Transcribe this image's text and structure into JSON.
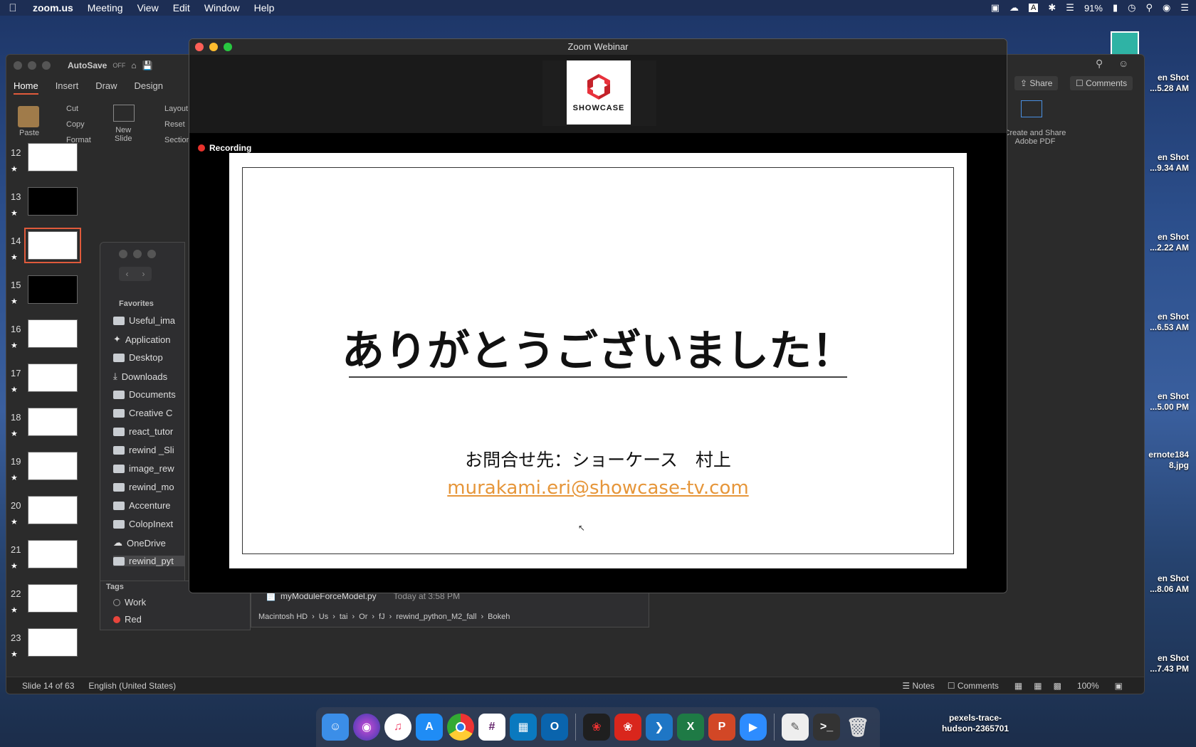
{
  "menubar": {
    "app_name": "zoom.us",
    "items": [
      "Meeting",
      "View",
      "Edit",
      "Window",
      "Help"
    ],
    "battery": "91%"
  },
  "desktop_icons": [
    {
      "line1": "en Shot",
      "line2": "...5.28 AM"
    },
    {
      "line1": "en Shot",
      "line2": "...9.34 AM"
    },
    {
      "line1": "en Shot",
      "line2": "...2.22 AM"
    },
    {
      "line1": "en Shot",
      "line2": "...6.53 AM"
    },
    {
      "line1": "en Shot",
      "line2": "...5.00 PM"
    },
    {
      "line1": "ernote184",
      "line2": "8.jpg"
    },
    {
      "line1": "en Shot",
      "line2": "...8.06 AM"
    },
    {
      "line1": "en Shot",
      "line2": "...7.43 PM"
    }
  ],
  "desktop_bottom_label": {
    "line1": "pexels-trace-",
    "line2": "hudson-2365701"
  },
  "ppt": {
    "autosave_label": "AutoSave",
    "autosave_state": "OFF",
    "tabs": [
      "Home",
      "Insert",
      "Draw",
      "Design"
    ],
    "paste": "Paste",
    "cut": "Cut",
    "copy": "Copy",
    "format": "Format",
    "new_slide": "New\nSlide",
    "layout": "Layout",
    "reset": "Reset",
    "section": "Section",
    "share": "Share",
    "comments": "Comments",
    "create_share_pdf": "Create and Share Adobe PDF",
    "slides": [
      {
        "num": "12",
        "kind": "white"
      },
      {
        "num": "13",
        "kind": "black"
      },
      {
        "num": "14",
        "kind": "white",
        "selected": true
      },
      {
        "num": "15",
        "kind": "black"
      },
      {
        "num": "16",
        "kind": "white"
      },
      {
        "num": "17",
        "kind": "white"
      },
      {
        "num": "18",
        "kind": "white"
      },
      {
        "num": "19",
        "kind": "white"
      },
      {
        "num": "20",
        "kind": "white"
      },
      {
        "num": "21",
        "kind": "white"
      },
      {
        "num": "22",
        "kind": "white"
      },
      {
        "num": "23",
        "kind": "white"
      }
    ],
    "status_slide": "Slide 14 of 63",
    "status_language": "English (United States)",
    "notes": "Notes",
    "comments_btn": "Comments",
    "zoom_level": "100%"
  },
  "finder": {
    "favorites_heading": "Favorites",
    "favorites": [
      "Useful_ima",
      "Application",
      "Desktop",
      "Downloads",
      "Documents",
      "Creative C",
      "react_tutor",
      "rewind _Sli",
      "image_rew",
      "rewind_mo",
      "Accenture",
      "ColopInext",
      "OneDrive",
      "rewind_pyt"
    ],
    "tags_heading": "Tags",
    "tags": [
      {
        "name": "Work",
        "color": "#777777"
      },
      {
        "name": "Red",
        "color": "#e8453c"
      }
    ],
    "file_name": "myModuleForceModel.py",
    "file_date": "Today at 3:58 PM",
    "path": [
      "Macintosh HD",
      "Us",
      "tai",
      "Or",
      "fJ",
      "rewind_python_M2_fall",
      "Bokeh"
    ]
  },
  "zoom": {
    "window_title": "Zoom Webinar",
    "logo_text": "SHOWCASE",
    "recording_label": "Recording",
    "slide_title": "ありがとうございました！",
    "slide_contact": "お問合せ先：ショーケース　村上",
    "slide_email": "murakami.eri@showcase-tv.com"
  },
  "dock": {
    "apps": [
      "finder",
      "siri",
      "music",
      "app-store",
      "chrome",
      "slack",
      "trello",
      "outlook",
      "acrobat",
      "acrobat-reader",
      "vscode",
      "excel",
      "powerpoint",
      "zoom",
      "preview",
      "terminal",
      "trash"
    ]
  },
  "colors": {
    "accent_ppt": "#e05a3b",
    "email": "#e6963a",
    "recording": "#e8322c"
  }
}
